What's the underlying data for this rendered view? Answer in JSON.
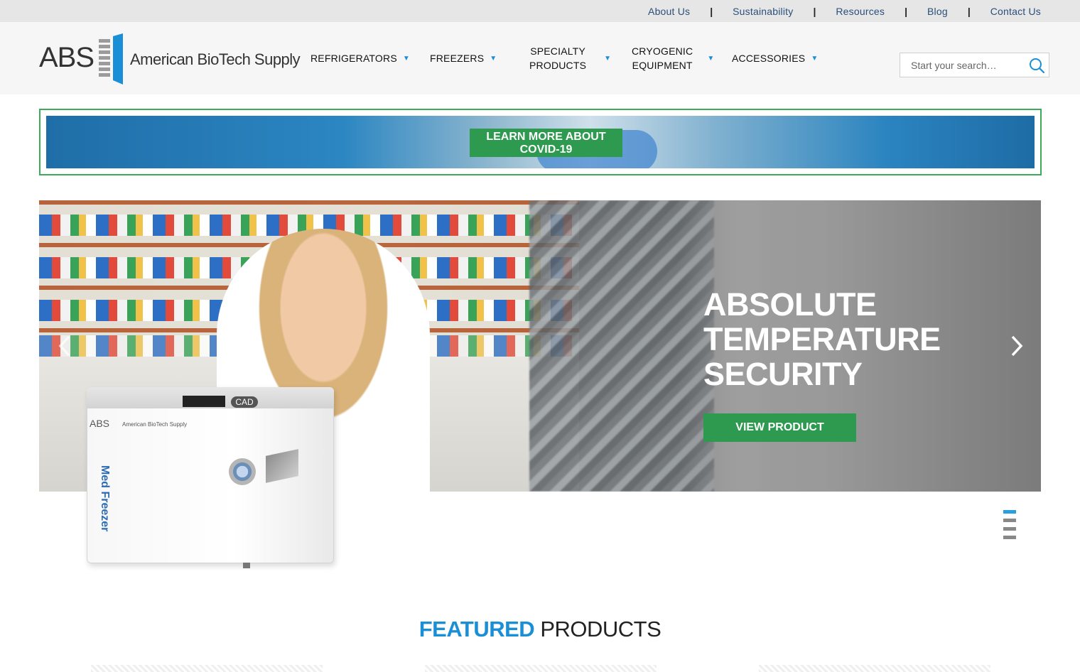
{
  "utility_nav": [
    "About Us",
    "Sustainability",
    "Resources",
    "Blog",
    "Contact Us"
  ],
  "brand": {
    "abbr": "ABS",
    "name": "American BioTech Supply",
    "accent": "#1a8fd6"
  },
  "main_nav": [
    {
      "label": "REFRIGERATORS",
      "icon": "caret-down-icon"
    },
    {
      "label": "FREEZERS",
      "icon": "caret-down-icon"
    },
    {
      "label_lines": [
        "SPECIALTY",
        "PRODUCTS"
      ],
      "icon": "caret-down-icon"
    },
    {
      "label_lines": [
        "CRYOGENIC",
        "EQUIPMENT"
      ],
      "icon": "caret-down-icon"
    },
    {
      "label": "ACCESSORIES",
      "icon": "caret-down-icon"
    }
  ],
  "search": {
    "placeholder": "Start your search…",
    "value": "",
    "icon": "search-icon"
  },
  "covid_banner": {
    "button_line1": "LEARN MORE ABOUT",
    "button_line2": "COVID-19",
    "border_color": "#3daa5a"
  },
  "hero": {
    "heading_lines": [
      "ABSOLUTE",
      "TEMPERATURE",
      "SECURITY"
    ],
    "cta": "VIEW PRODUCT",
    "cta_color": "#2e9a4f",
    "product_label": "Med Freezer",
    "product_badge": "CAD",
    "product_brand": "ABS",
    "product_company": "American BioTech Supply",
    "prev_icon": "chevron-left-icon",
    "next_icon": "chevron-right-icon"
  },
  "featured": {
    "strong": "FEATURED",
    "rest": " PRODUCTS"
  }
}
